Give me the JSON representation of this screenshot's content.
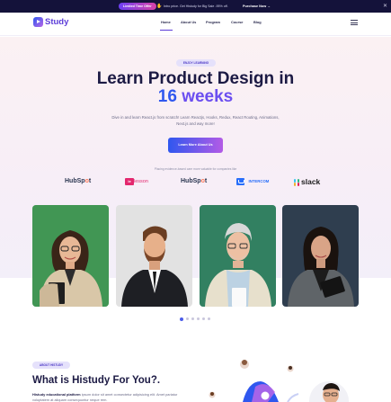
{
  "topbar": {
    "promo_label": "Limited Time Offer",
    "message": "Intro price. Get Histudy for Big Sale -95% off.",
    "cta_label": "Purchase Now →",
    "close_icon": "close-icon"
  },
  "header": {
    "logo_text": "Study",
    "nav": [
      "Home",
      "About Us",
      "Program",
      "Course",
      "Blog"
    ],
    "active_nav": "Home",
    "menu_icon": "hamburger-icon"
  },
  "hero": {
    "badge": "ENJOY LEARNING",
    "title_line1": "Learn Product Design in",
    "title_num": "16",
    "title_word": "weeks",
    "subtitle": "Dive in and learn React.js from scratch! Learn Reactjs, Hooks, Redux, React Routing, Animations, Next.js and way more!",
    "button_label": "Learn More About Us",
    "trusted_text": "Placing evidence-based care more valuable for companies like"
  },
  "brands": {
    "hubspot_a": "HubSp",
    "hubspot_b": "t",
    "lesson": "lesson",
    "lesson_mark": "le",
    "intercom": "INTERCOM",
    "slack": "slack"
  },
  "carousel": {
    "people": [
      "woman-green-background",
      "man-beard-suit",
      "older-man-glasses",
      "woman-tablet"
    ],
    "active_dot": 0,
    "dot_count": 6
  },
  "about": {
    "badge": "ABOUT HISTUDY",
    "title": "What is Histudy For You?.",
    "text_bold": "Histudy educational platform",
    "text": " ipsum dolor sit amet consectetur adipisicing elit. Amet pariatur voluptatem at aliquam consequuntur neque rem."
  },
  "colors": {
    "brand": "#5b3bd8",
    "accent_blue": "#2f57ef",
    "accent_purple": "#b966e7",
    "dark": "#1c1a44"
  }
}
